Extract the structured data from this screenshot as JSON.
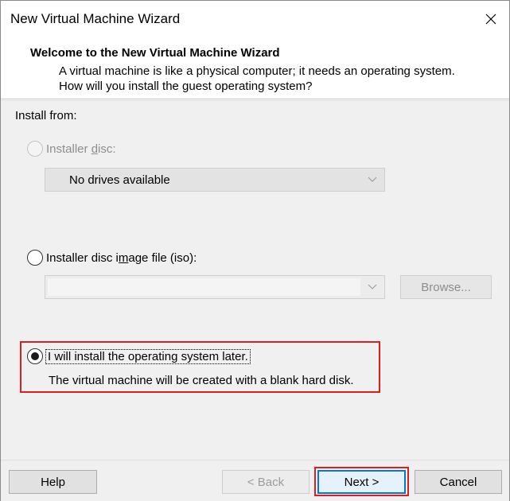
{
  "window": {
    "title": "New Virtual Machine Wizard"
  },
  "header": {
    "title": "Welcome to the New Virtual Machine Wizard",
    "description": "A virtual machine is like a physical computer; it needs an operating system. How will you install the guest operating system?"
  },
  "body": {
    "install_from_label": "Install from:",
    "options": [
      {
        "label": "Installer disc:",
        "selected": false,
        "enabled": false,
        "mnemonic": "d"
      },
      {
        "label": "Installer disc image file (iso):",
        "selected": false,
        "enabled": true,
        "mnemonic": "m"
      },
      {
        "label": "I will install the operating system later.",
        "selected": true,
        "enabled": true,
        "mnemonic": ""
      }
    ],
    "disc_dropdown": {
      "value": "No drives available",
      "enabled": false
    },
    "iso_path": {
      "value": "",
      "enabled": false
    },
    "browse_label": "Browse...",
    "later_description": "The virtual machine will be created with a blank hard disk."
  },
  "footer": {
    "help_label": "Help",
    "back_label": "< Back",
    "next_label": "Next >",
    "cancel_label": "Cancel"
  },
  "colors": {
    "accent": "#0078d7",
    "highlight_red": "#dd1e1e",
    "disabled_text": "#8d8d8d",
    "body_bg": "#f0f0f0"
  },
  "icons": {
    "close": "close-icon",
    "dropdown": "chevron-down-icon"
  }
}
